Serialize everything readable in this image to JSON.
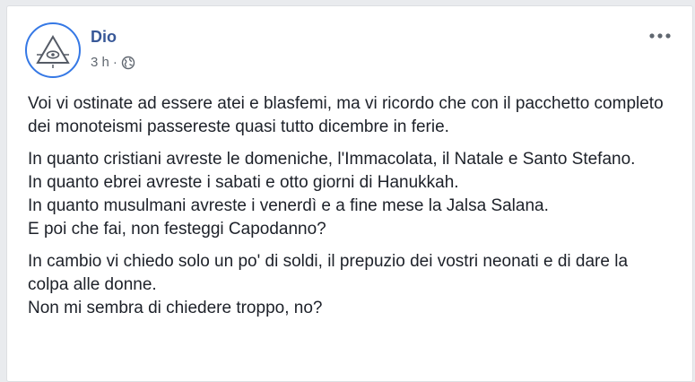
{
  "post": {
    "author": "Dio",
    "timestamp": "3 h",
    "separator": "·",
    "privacy_icon": "globe-icon",
    "more_icon": "more-options-icon",
    "avatar_icon": "all-seeing-eye-triangle-icon",
    "paragraphs": [
      "Voi vi ostinate ad essere atei e blasfemi, ma vi ricordo che con il pacchetto completo dei monoteismi passereste quasi tutto dicembre in ferie.",
      "In quanto cristiani avreste le domeniche, l'Immacolata, il Natale e Santo Stefano.\nIn quanto ebrei avreste i sabati e otto giorni di Hanukkah.\nIn quanto musulmani avreste i venerdì e a fine mese la Jalsa Salana.\nE poi che fai, non festeggi Capodanno?",
      "In cambio vi chiedo solo un po' di soldi, il prepuzio dei vostri neonati e di dare la colpa alle donne.\nNon mi sembra di chiedere troppo, no?"
    ]
  },
  "colors": {
    "author": "#385898",
    "meta": "#606770",
    "text": "#1d2129",
    "avatar_ring": "#3578e5",
    "background": "#e9ebee"
  }
}
